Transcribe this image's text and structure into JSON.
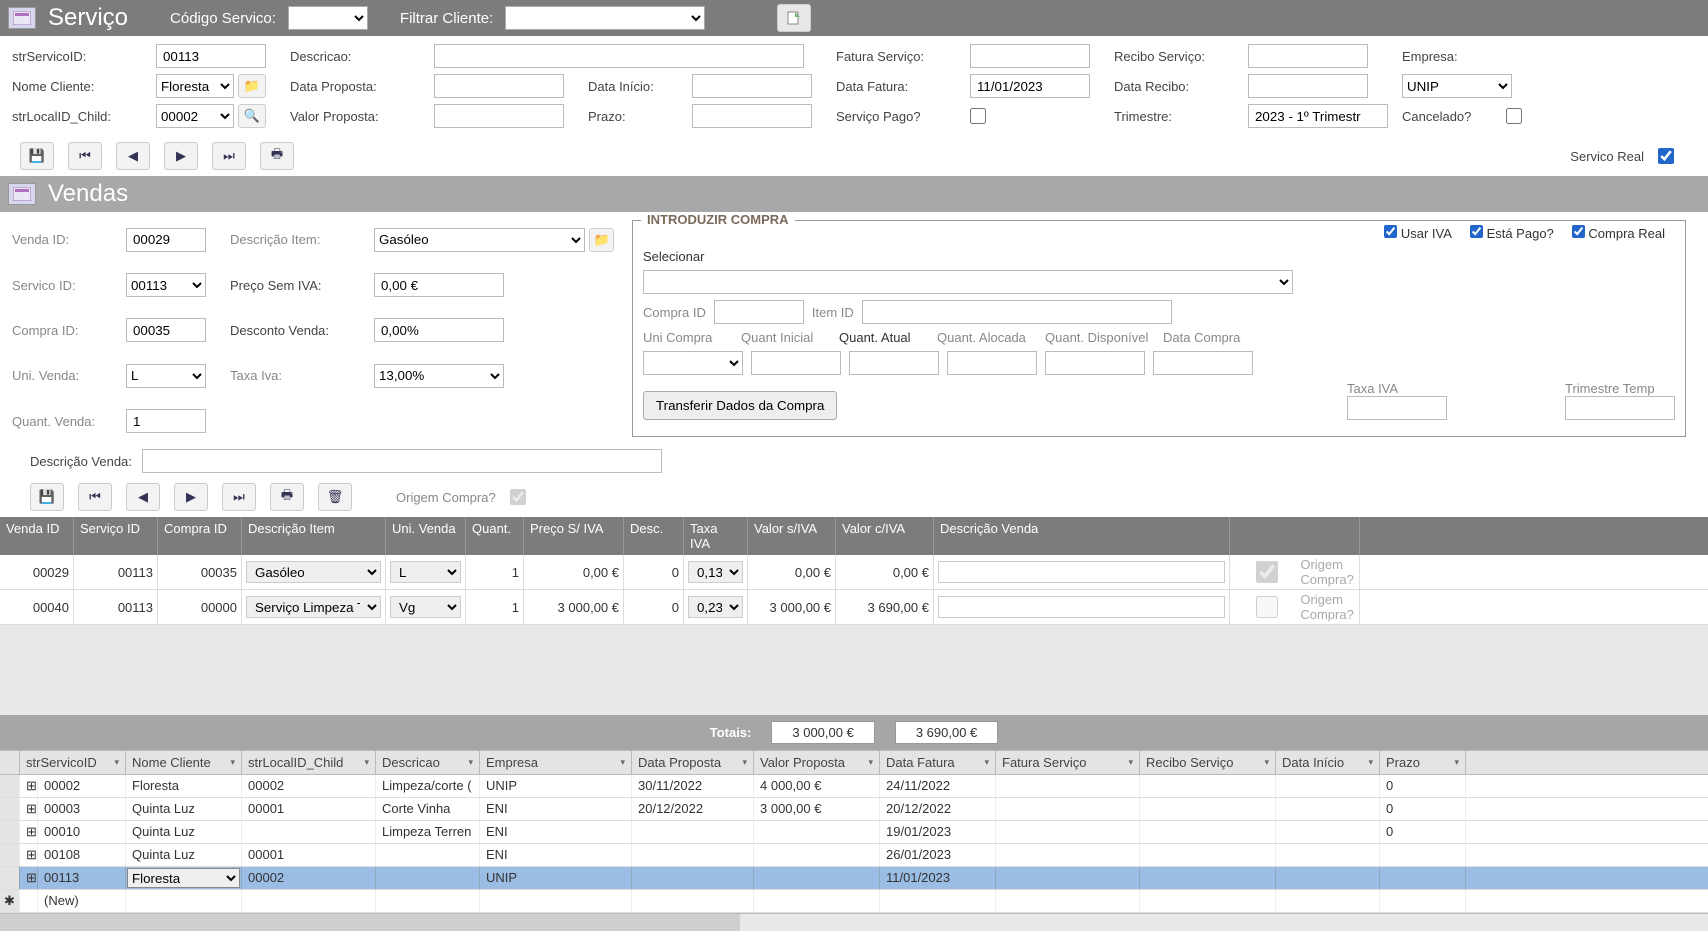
{
  "servico_header": {
    "title": "Serviço",
    "codigo_label": "Código Servico:",
    "filtrar_label": "Filtrar Cliente:"
  },
  "servico_form": {
    "strServicoID_label": "strServicoID:",
    "strServicoID": "00113",
    "descricao_label": "Descricao:",
    "descricao": "",
    "fatura_servico_label": "Fatura Serviço:",
    "fatura_servico": "",
    "recibo_servico_label": "Recibo Serviço:",
    "recibo_servico": "",
    "empresa_label": "Empresa:",
    "nome_cliente_label": "Nome Cliente:",
    "nome_cliente": "Floresta",
    "data_proposta_label": "Data Proposta:",
    "data_proposta": "",
    "data_inicio_label": "Data Início:",
    "data_inicio": "",
    "data_fatura_label": "Data Fatura:",
    "data_fatura": "11/01/2023",
    "data_recibo_label": "Data Recibo:",
    "data_recibo": "",
    "empresa": "UNIP",
    "strLocalID_label": "strLocalID_Child:",
    "strLocalID": "00002",
    "valor_proposta_label": "Valor Proposta:",
    "valor_proposta": "",
    "prazo_label": "Prazo:",
    "prazo": "",
    "servico_pago_label": "Serviço Pago?",
    "trimestre_label": "Trimestre:",
    "trimestre": "2023 - 1º Trimestr",
    "cancelado_label": "Cancelado?",
    "servico_real_label": "Servico Real"
  },
  "vendas_header": {
    "title": "Vendas"
  },
  "vendas_form": {
    "venda_id_label": "Venda ID:",
    "venda_id": "00029",
    "descricao_item_label": "Descrição Item:",
    "descricao_item": "Gasóleo",
    "servico_id_label": "Servico ID:",
    "servico_id": "00113",
    "preco_sem_iva_label": "Preço Sem IVA:",
    "preco_sem_iva": "0,00 €",
    "compra_id_label": "Compra ID:",
    "compra_id": "00035",
    "desconto_label": "Desconto Venda:",
    "desconto": "0,00%",
    "uni_venda_label": "Uni. Venda:",
    "uni_venda": "L",
    "taxa_iva_label": "Taxa Iva:",
    "taxa_iva": "13,00%",
    "quant_venda_label": "Quant. Venda:",
    "quant_venda": "1",
    "descricao_venda_label": "Descrição Venda:",
    "descricao_venda": "",
    "origem_compra_label": "Origem Compra?"
  },
  "compra_box": {
    "title": "INTRODUZIR COMPRA",
    "usar_iva": "Usar IVA",
    "esta_pago": "Está Pago?",
    "compra_real": "Compra Real",
    "selecionar": "Selecionar",
    "compra_id": "Compra ID",
    "item_id": "Item ID",
    "uni_compra": "Uni Compra",
    "quant_inicial": "Quant Inicial",
    "quant_atual": "Quant. Atual",
    "quant_alocada": "Quant. Alocada",
    "quant_disponivel": "Quant. Disponível",
    "data_compra": "Data Compra",
    "transferir": "Transferir Dados da Compra",
    "taxa_iva": "Taxa IVA",
    "trimestre_temp": "Trimestre Temp"
  },
  "grid": {
    "headers": {
      "venda_id": "Venda ID",
      "servico_id": "Serviço ID",
      "compra_id": "Compra ID",
      "descricao_item": "Descrição Item",
      "uni_venda": "Uni. Venda",
      "quant": "Quant.",
      "preco": "Preço S/ IVA",
      "desc": "Desc.",
      "taxa_iva": "Taxa IVA",
      "valor_siva": "Valor s/IVA",
      "valor_civa": "Valor c/IVA",
      "descricao_venda": "Descrição Venda",
      "origem_compra": "Origem Compra?"
    },
    "rows": [
      {
        "venda_id": "00029",
        "servico_id": "00113",
        "compra_id": "00035",
        "descricao_item": "Gasóleo",
        "uni": "L",
        "quant": "1",
        "preco": "0,00 €",
        "desc": "0",
        "taxa": "0,13",
        "vsiva": "0,00 €",
        "vciva": "0,00 €",
        "oc_checked": true
      },
      {
        "venda_id": "00040",
        "servico_id": "00113",
        "compra_id": "00000",
        "descricao_item": "Serviço Limpeza Te",
        "uni": "Vg",
        "quant": "1",
        "preco": "3 000,00 €",
        "desc": "0",
        "taxa": "0,23",
        "vsiva": "3 000,00 €",
        "vciva": "3 690,00 €",
        "oc_checked": false
      }
    ],
    "totals_label": "Totais:",
    "total_siva": "3 000,00 €",
    "total_civa": "3 690,00 €"
  },
  "datasheet": {
    "headers": [
      "strServicoID",
      "Nome Cliente",
      "strLocalID_Child",
      "Descricao",
      "Empresa",
      "Data Proposta",
      "Valor Proposta",
      "Data Fatura",
      "Fatura Serviço",
      "Recibo Serviço",
      "Data Início",
      "Prazo"
    ],
    "rows": [
      {
        "id": "00002",
        "cliente": "Floresta",
        "local": "00002",
        "desc": "Limpeza/corte (",
        "emp": "UNIP",
        "dprop": "30/11/2022",
        "vprop": "4 000,00 €",
        "dfat": "24/11/2022",
        "fat": "",
        "rec": "",
        "dini": "",
        "prazo": "0"
      },
      {
        "id": "00003",
        "cliente": "Quinta Luz",
        "local": "00001",
        "desc": "Corte Vinha",
        "emp": "ENI",
        "dprop": "20/12/2022",
        "vprop": "3 000,00 €",
        "dfat": "20/12/2022",
        "fat": "",
        "rec": "",
        "dini": "",
        "prazo": "0"
      },
      {
        "id": "00010",
        "cliente": "Quinta Luz",
        "local": "",
        "desc": "Limpeza Terren",
        "emp": "ENI",
        "dprop": "",
        "vprop": "",
        "dfat": "19/01/2023",
        "fat": "",
        "rec": "",
        "dini": "",
        "prazo": "0"
      },
      {
        "id": "00108",
        "cliente": "Quinta Luz",
        "local": "00001",
        "desc": "",
        "emp": "ENI",
        "dprop": "",
        "vprop": "",
        "dfat": "26/01/2023",
        "fat": "",
        "rec": "",
        "dini": "",
        "prazo": ""
      },
      {
        "id": "00113",
        "cliente": "Floresta",
        "local": "00002",
        "desc": "",
        "emp": "UNIP",
        "dprop": "",
        "vprop": "",
        "dfat": "11/01/2023",
        "fat": "",
        "rec": "",
        "dini": "",
        "prazo": "",
        "selected": true
      }
    ],
    "new_row": "(New)"
  }
}
